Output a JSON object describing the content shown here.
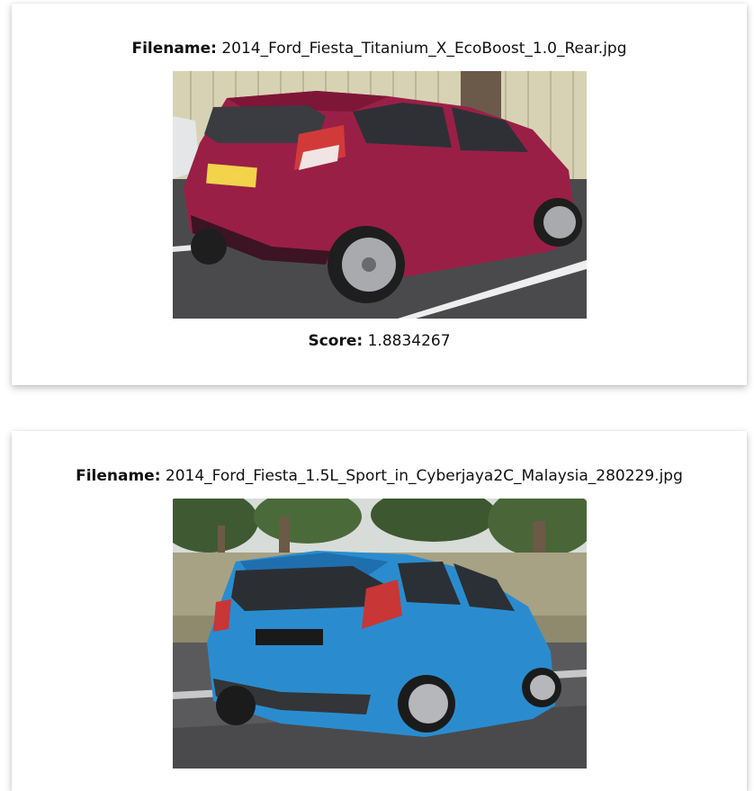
{
  "results": [
    {
      "filename_label": "Filename:",
      "filename": "2014_Ford_Fiesta_Titanium_X_EcoBoost_1.0_Rear.jpg",
      "score_label": "Score:",
      "score": "1.8834267",
      "image_subject": "magenta hatchback rear view"
    },
    {
      "filename_label": "Filename:",
      "filename": "2014_Ford_Fiesta_1.5L_Sport_in_Cyberjaya2C_Malaysia_280229.jpg",
      "image_subject": "blue hatchback rear view"
    }
  ]
}
